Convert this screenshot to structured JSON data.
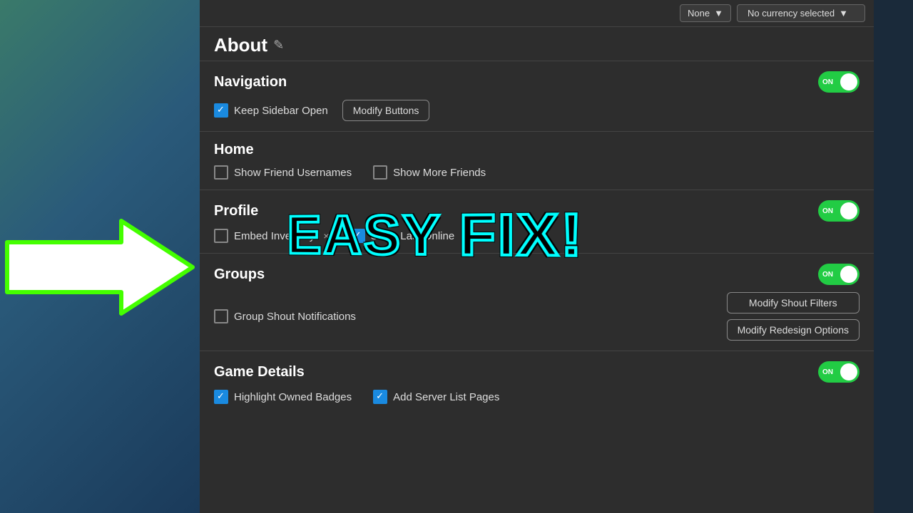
{
  "topbar": {
    "none_label": "None",
    "currency_label": "No currency selected"
  },
  "about": {
    "title": "About",
    "edit_icon": "✎"
  },
  "sections": {
    "navigation": {
      "title": "Navigation",
      "toggle": "ON",
      "keep_sidebar_open": "Keep Sidebar Open",
      "modify_buttons": "Modify Buttons"
    },
    "home": {
      "title": "Home",
      "show_friend_usernames": "Show Friend Usernames",
      "show_more_friends": "Show More Friends"
    },
    "profile": {
      "title": "Profile",
      "toggle": "ON",
      "embed_inventory": "Embed Inventory",
      "embed_inventory_close": "×",
      "show_last_online": "Show Last Online"
    },
    "groups": {
      "title": "Groups",
      "toggle": "ON",
      "group_shout_notifications": "Group Shout Notifications",
      "modify_shout_filters": "Modify Shout Filters",
      "modify_redesign_options": "Modify Redesign Options"
    },
    "game_details": {
      "title": "Game Details",
      "toggle": "ON",
      "highlight_owned_badges": "Highlight Owned Badges",
      "add_server_list_pages": "Add Server List Pages"
    }
  },
  "overlay": {
    "easy_fix": "EASY FIX!"
  }
}
